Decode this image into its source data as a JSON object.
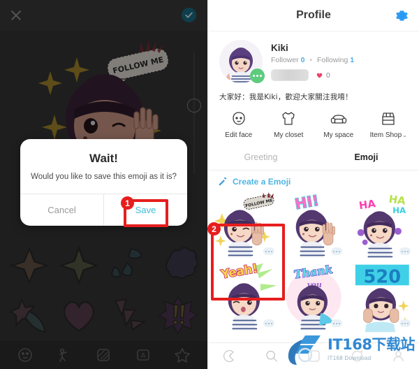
{
  "editor": {
    "close_icon": "close-x-icon",
    "confirm_icon": "check-circle-icon",
    "slider_name": "size-slider",
    "stickers": [
      {
        "name": "four-point-star-sticker"
      },
      {
        "name": "sparkle-star-sticker"
      },
      {
        "name": "teardrops-sticker"
      },
      {
        "name": "cloud-burst-sticker"
      },
      {
        "name": "shooting-star-sticker"
      },
      {
        "name": "heart-sticker"
      },
      {
        "name": "motion-lines-sticker"
      },
      {
        "name": "exclamation-burst-sticker"
      }
    ],
    "bottom_nav": [
      {
        "name": "face-icon"
      },
      {
        "name": "pose-icon"
      },
      {
        "name": "pattern-icon"
      },
      {
        "name": "text-icon"
      },
      {
        "name": "sticker-star-icon"
      }
    ],
    "avatar_speech": "FOLLOW ME"
  },
  "dialog": {
    "title": "Wait!",
    "message": "Would you like to save this emoji as it is?",
    "cancel_label": "Cancel",
    "save_label": "Save"
  },
  "annotations": [
    {
      "number": "1",
      "target": "save-button"
    },
    {
      "number": "2",
      "target": "first-emoji-tile"
    }
  ],
  "profile": {
    "header_title": "Profile",
    "settings_icon": "gear-icon",
    "settings_color": "#2196f3",
    "name": "Kiki",
    "follower_label": "Follower",
    "follower_count": "0",
    "separator": "•",
    "following_label": "Following",
    "following_count": "1",
    "like_count": "0",
    "bio": "大家好：我是Kiki，歡迎大家關注我唷！",
    "status_dots": "online-badge",
    "accent_color": "#4aaee8",
    "heart_color": "#e8456a",
    "actions": [
      {
        "label": "Edit face",
        "icon": "face-outline-icon",
        "chevron": ""
      },
      {
        "label": "My closet",
        "icon": "shirt-outline-icon",
        "chevron": ""
      },
      {
        "label": "My space",
        "icon": "sofa-outline-icon",
        "chevron": ""
      },
      {
        "label": "Item Shop",
        "icon": "shop-outline-icon",
        "chevron": "⌄"
      }
    ],
    "tabs": [
      {
        "label": "Greeting",
        "active": false
      },
      {
        "label": "Emoji",
        "active": true
      }
    ],
    "create_label": "Create a Emoji",
    "create_icon": "pencil-icon",
    "emojis": [
      {
        "name": "emoji-follow-me",
        "caption": "FOLLOW ME"
      },
      {
        "name": "emoji-hi",
        "caption": "HI!"
      },
      {
        "name": "emoji-haha",
        "caption": "HA HA"
      },
      {
        "name": "emoji-yeah",
        "caption": "Yeah!"
      },
      {
        "name": "emoji-thank-you",
        "caption": "Thank you"
      },
      {
        "name": "emoji-520",
        "caption": "520"
      }
    ],
    "bottom_nav": [
      {
        "name": "avatar-nav-icon"
      },
      {
        "name": "search-nav-icon"
      },
      {
        "name": "feed-nav-icon"
      },
      {
        "name": "chat-nav-icon"
      },
      {
        "name": "profile-nav-icon"
      }
    ]
  },
  "watermark": {
    "main": "IT168下载站",
    "sub": "IT168 Download"
  }
}
